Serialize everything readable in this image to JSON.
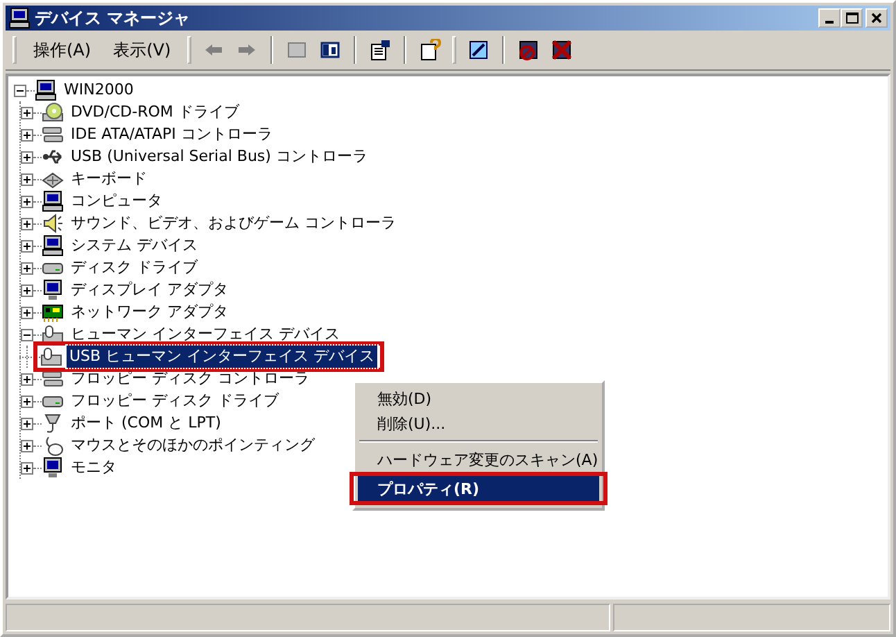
{
  "window": {
    "title": "デバイス マネージャ"
  },
  "menu_bar": [
    {
      "label": "操作(A)"
    },
    {
      "label": "表示(V)"
    }
  ],
  "toolbar_groups": [
    [
      {
        "disabled": true
      },
      {
        "disabled": true
      }
    ],
    [
      {
        "disabled": true
      },
      {
        "disabled": false
      }
    ],
    [
      {
        "disabled": false
      }
    ],
    [
      {
        "disabled": false
      }
    ],
    [
      {
        "disabled": false
      }
    ],
    [
      {
        "disabled": false
      },
      {
        "disabled": false
      }
    ]
  ],
  "tree": {
    "label": "WIN2000",
    "expanded": true,
    "selected": false,
    "children": [
      {
        "label": "DVD/CD-ROM ドライブ",
        "expanded": false,
        "selected": false
      },
      {
        "label": "IDE ATA/ATAPI コントローラ",
        "expanded": false,
        "selected": false
      },
      {
        "label": "USB (Universal Serial Bus) コントローラ",
        "expanded": false,
        "selected": false
      },
      {
        "label": "キーボード",
        "expanded": false,
        "selected": false
      },
      {
        "label": "コンピュータ",
        "expanded": false,
        "selected": false
      },
      {
        "label": "サウンド、ビデオ、およびゲーム コントローラ",
        "expanded": false,
        "selected": false
      },
      {
        "label": "システム デバイス",
        "expanded": false,
        "selected": false
      },
      {
        "label": "ディスク ドライブ",
        "expanded": false,
        "selected": false
      },
      {
        "label": "ディスプレイ アダプタ",
        "expanded": false,
        "selected": false
      },
      {
        "label": "ネットワーク アダプタ",
        "expanded": false,
        "selected": false
      },
      {
        "label": "ヒューマン インターフェイス デバイス",
        "expanded": true,
        "selected": false,
        "children": [
          {
            "label": "USB ヒューマン インターフェイス デバイス",
            "selected": true
          }
        ]
      },
      {
        "label": "フロッピー ディスク コントローラ",
        "expanded": false,
        "selected": false
      },
      {
        "label": "フロッピー ディスク ドライブ",
        "expanded": false,
        "selected": false
      },
      {
        "label": "ポート (COM と LPT)",
        "expanded": false,
        "selected": false
      },
      {
        "label": "マウスとそのほかのポインティング",
        "expanded": false,
        "selected": false
      },
      {
        "label": "モニタ",
        "expanded": false,
        "selected": false
      }
    ]
  },
  "context_menu": [
    {
      "kind": "item",
      "label": "無効(D)",
      "selected": false
    },
    {
      "kind": "item",
      "label": "削除(U)...",
      "selected": false
    },
    {
      "kind": "separator"
    },
    {
      "kind": "item",
      "label": "ハードウェア変更のスキャン(A)",
      "selected": false
    },
    {
      "kind": "item",
      "label": "プロパティ(R)",
      "selected": true
    }
  ]
}
